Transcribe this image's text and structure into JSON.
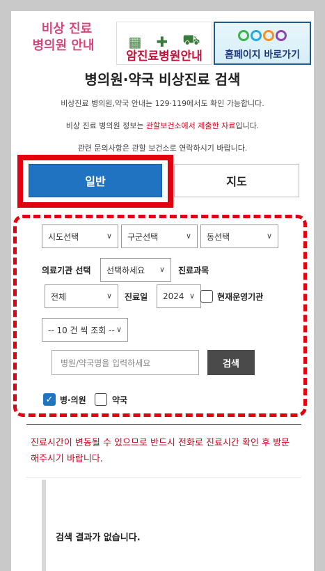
{
  "banners": {
    "left_line1": "비상 진료",
    "left_line2": "병의원 안내",
    "middle": "암진료병원안내",
    "right": "홈페이지 바로가기"
  },
  "title": "병의원·약국 비상진료 검색",
  "info": {
    "line1": "비상진료 병의원,약국 안내는 129·119에서도 확인 가능합니다.",
    "line2_pre": "비상 진료 병의원 정보는 ",
    "line2_red": "관할보건소에서 제출한 자료",
    "line2_post": "입니다.",
    "line3": "관련 문의사항은 관할 보건소로 연락하시기 바랍니다."
  },
  "tabs": {
    "general": "일반",
    "map": "지도"
  },
  "filters": {
    "sido": "시도선택",
    "gugun": "구군선택",
    "dong": "동선택",
    "institution_label": "의료기관 선택",
    "institution_value": "선택하세요",
    "department_label": "진료과목",
    "department_value": "전체",
    "date_label": "진료일",
    "year_value": "2024",
    "open_label": "현재운영기관",
    "page_size": "-- 10 건 씩 조회 --"
  },
  "search": {
    "placeholder": "병원/약국명을 입력하세요",
    "button": "검색"
  },
  "types": {
    "hospital": "병·의원",
    "pharmacy": "약국"
  },
  "notice": "진료시간이 변동될 수 있으므로 반드시 전화로 진료시간 확인 후 방문해주시기 바랍니다.",
  "result": "검색 결과가 없습니다.",
  "colors": {
    "accent": "#1f73c0",
    "highlight": "#e3000f",
    "notice": "#d0021b"
  }
}
